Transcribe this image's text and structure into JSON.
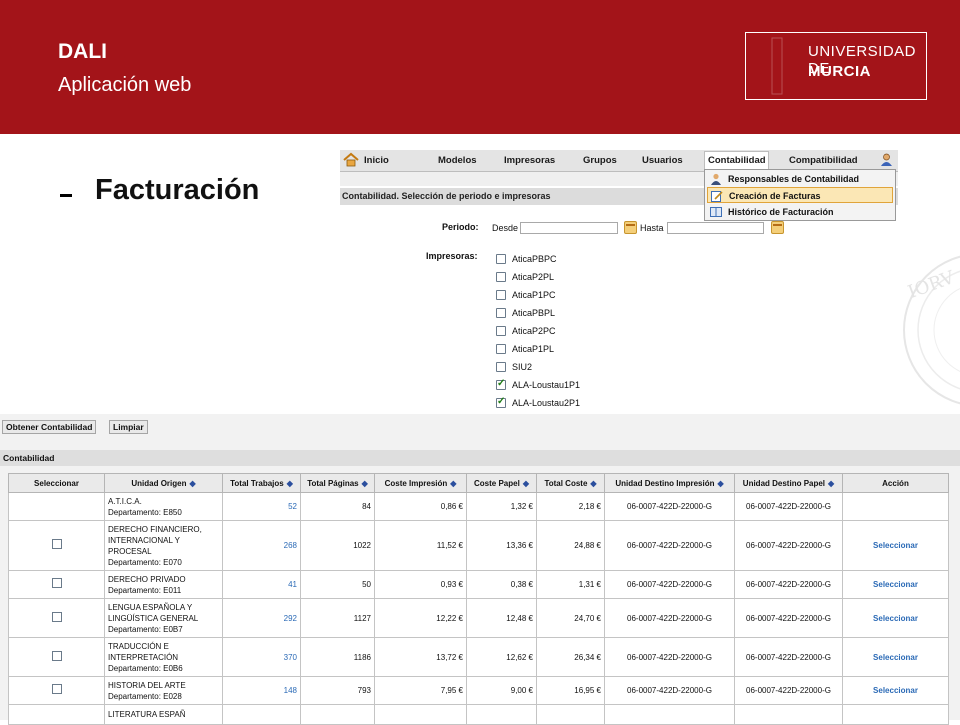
{
  "header": {
    "title": "DALI",
    "subtitle": "Aplicación web",
    "logo_line1": "UNIVERSIDAD DE",
    "logo_line2": "MURCIA",
    "color": "#a31419"
  },
  "slide": {
    "heading": "Facturación"
  },
  "app": {
    "nav": {
      "home": "Inicio",
      "items": [
        "Modelos",
        "Impresoras",
        "Grupos",
        "Usuarios",
        "Contabilidad",
        "Compatibilidad"
      ],
      "active": "Contabilidad"
    },
    "dropdown": [
      {
        "label": "Responsables de Contabilidad",
        "icon": "person-icon"
      },
      {
        "label": "Creación de Facturas",
        "icon": "edit-icon",
        "highlighted": true
      },
      {
        "label": "Histórico de Facturación",
        "icon": "book-icon"
      }
    ],
    "section_title": "Contabilidad. Selección de periodo e impresoras",
    "periodo_label": "Periodo:",
    "desde_label": "Desde",
    "hasta_label": "Hasta",
    "impresoras_label": "Impresoras:",
    "printers": [
      {
        "name": "AticaPBPC",
        "checked": false
      },
      {
        "name": "AticaP2PL",
        "checked": false
      },
      {
        "name": "AticaP1PC",
        "checked": false
      },
      {
        "name": "AticaPBPL",
        "checked": false
      },
      {
        "name": "AticaP2PC",
        "checked": false
      },
      {
        "name": "AticaP1PL",
        "checked": false
      },
      {
        "name": "SIU2",
        "checked": false
      },
      {
        "name": "ALA-Loustau1P1",
        "checked": true
      },
      {
        "name": "ALA-Loustau2P1",
        "checked": true
      }
    ]
  },
  "bottom": {
    "buttons": [
      "Obtener Contabilidad",
      "Limpiar"
    ],
    "section_title": "Contabilidad",
    "columns": [
      "Seleccionar",
      "Unidad Origen",
      "Total Trabajos",
      "Total Páginas",
      "Coste Impresión",
      "Coste Papel",
      "Total Coste",
      "Unidad Destino Impresión",
      "Unidad Destino Papel",
      "Acción"
    ],
    "rows": [
      {
        "checkbox": false,
        "origen": [
          "A.T.I.C.A.",
          "Departamento: E850"
        ],
        "trabajos": "52",
        "paginas": "84",
        "coste_impresion": "0,86 €",
        "coste_papel": "1,32 €",
        "total": "2,18 €",
        "destino_impresion": "06-0007-422D-22000-G",
        "destino_papel": "06-0007-422D-22000-G",
        "accion": ""
      },
      {
        "checkbox": true,
        "origen": [
          "DERECHO FINANCIERO,",
          "INTERNACIONAL Y",
          "PROCESAL",
          "Departamento: E070"
        ],
        "trabajos": "268",
        "paginas": "1022",
        "coste_impresion": "11,52 €",
        "coste_papel": "13,36 €",
        "total": "24,88 €",
        "destino_impresion": "06-0007-422D-22000-G",
        "destino_papel": "06-0007-422D-22000-G",
        "accion": "Seleccionar"
      },
      {
        "checkbox": true,
        "origen": [
          "DERECHO PRIVADO",
          "Departamento: E011"
        ],
        "trabajos": "41",
        "paginas": "50",
        "coste_impresion": "0,93 €",
        "coste_papel": "0,38 €",
        "total": "1,31 €",
        "destino_impresion": "06-0007-422D-22000-G",
        "destino_papel": "06-0007-422D-22000-G",
        "accion": "Seleccionar"
      },
      {
        "checkbox": true,
        "origen": [
          "LENGUA ESPAÑOLA Y",
          "LINGÜÍSTICA GENERAL",
          "Departamento: E0B7"
        ],
        "trabajos": "292",
        "paginas": "1127",
        "coste_impresion": "12,22 €",
        "coste_papel": "12,48 €",
        "total": "24,70 €",
        "destino_impresion": "06-0007-422D-22000-G",
        "destino_papel": "06-0007-422D-22000-G",
        "accion": "Seleccionar"
      },
      {
        "checkbox": true,
        "origen": [
          "TRADUCCIÓN E",
          "INTERPRETACIÓN",
          "Departamento: E0B6"
        ],
        "trabajos": "370",
        "paginas": "1186",
        "coste_impresion": "13,72 €",
        "coste_papel": "12,62 €",
        "total": "26,34 €",
        "destino_impresion": "06-0007-422D-22000-G",
        "destino_papel": "06-0007-422D-22000-G",
        "accion": "Seleccionar"
      },
      {
        "checkbox": true,
        "origen": [
          "HISTORIA DEL ARTE",
          "Departamento: E028"
        ],
        "trabajos": "148",
        "paginas": "793",
        "coste_impresion": "7,95 €",
        "coste_papel": "9,00 €",
        "total": "16,95 €",
        "destino_impresion": "06-0007-422D-22000-G",
        "destino_papel": "06-0007-422D-22000-G",
        "accion": "Seleccionar"
      },
      {
        "checkbox": false,
        "origen": [
          "LITERATURA ESPAÑ"
        ],
        "trabajos": "",
        "paginas": "",
        "coste_impresion": "",
        "coste_papel": "",
        "total": "",
        "destino_impresion": "",
        "destino_papel": "",
        "accion": ""
      }
    ]
  }
}
